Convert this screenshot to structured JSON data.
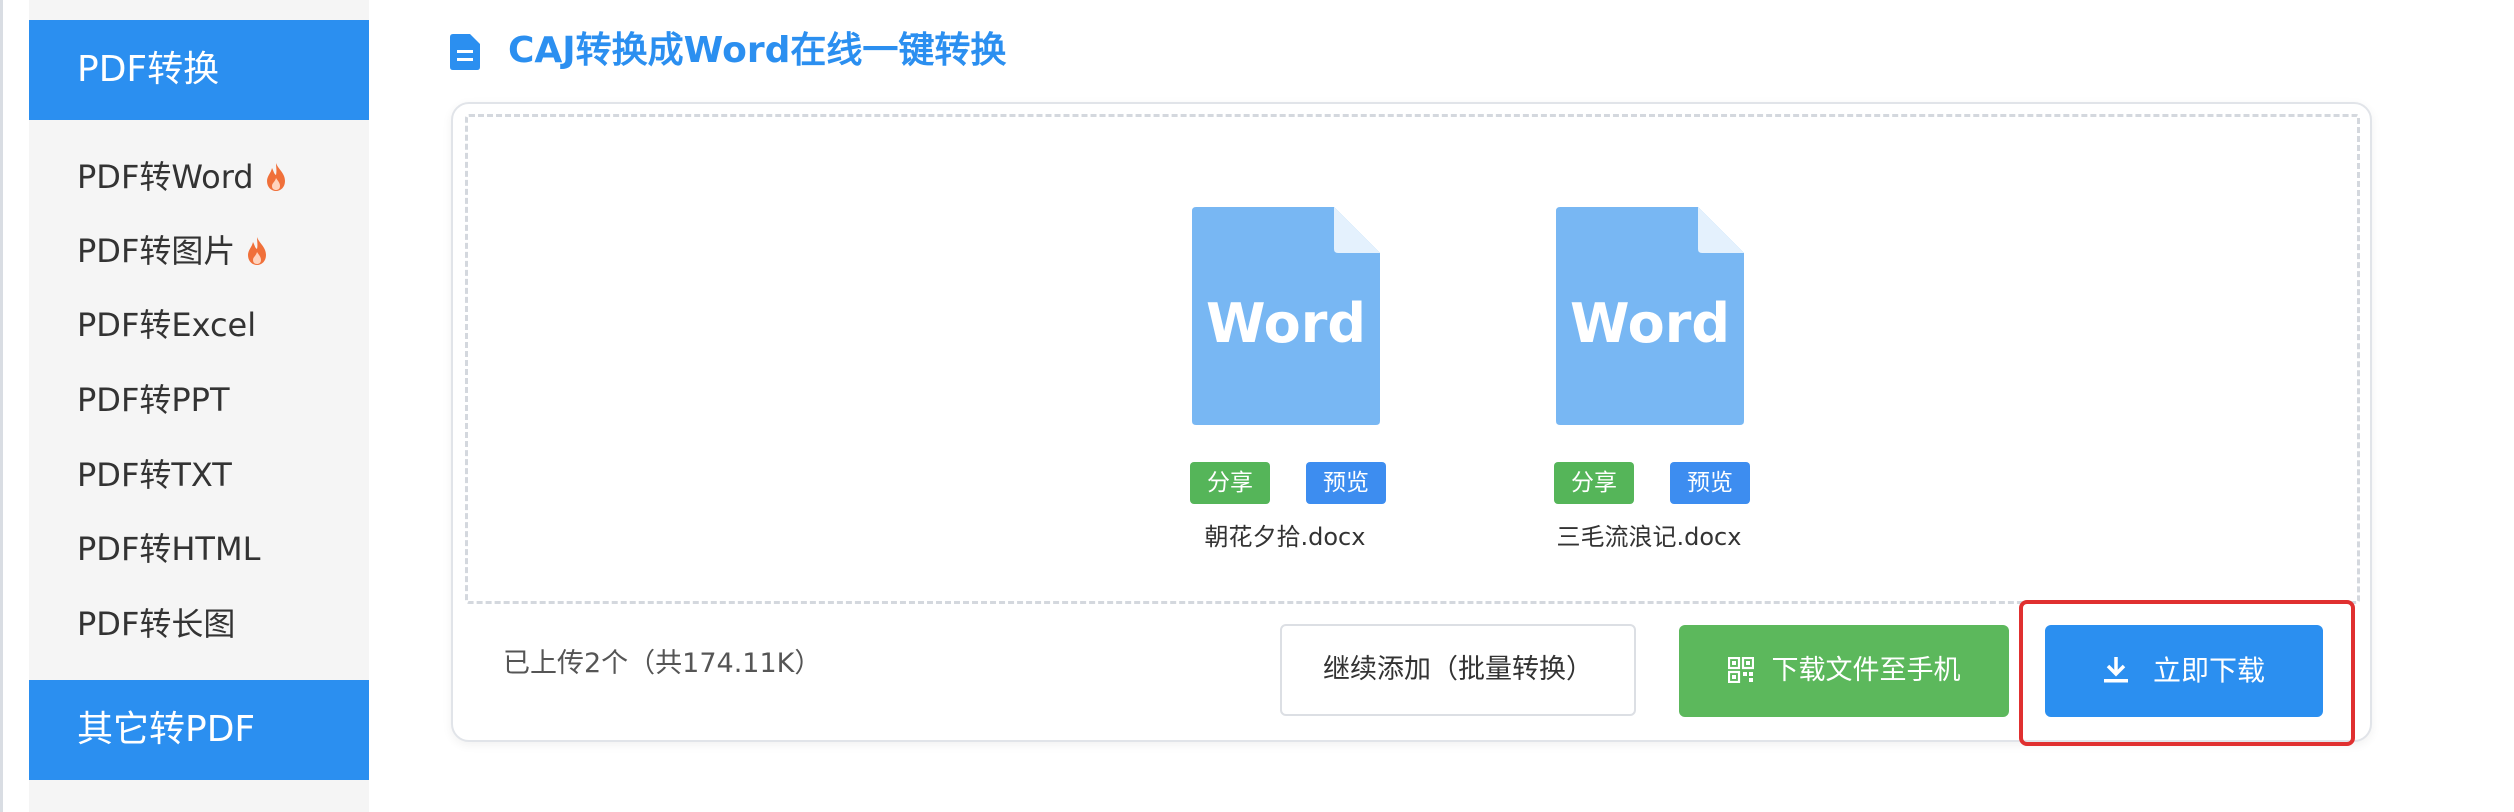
{
  "sidebar": {
    "pdf_section": "PDF转换",
    "items": [
      {
        "label": "PDF转Word",
        "hot": true
      },
      {
        "label": "PDF转图片",
        "hot": true
      },
      {
        "label": "PDF转Excel",
        "hot": false
      },
      {
        "label": "PDF转PPT",
        "hot": false
      },
      {
        "label": "PDF转TXT",
        "hot": false
      },
      {
        "label": "PDF转HTML",
        "hot": false
      },
      {
        "label": "PDF转长图",
        "hot": false
      }
    ],
    "other_section": "其它转PDF"
  },
  "main": {
    "title": "CAJ转换成Word在线一键转换",
    "files": [
      {
        "icon_text": "Word",
        "name": "朝花夕拾.docx",
        "share_label": "分享",
        "preview_label": "预览"
      },
      {
        "icon_text": "Word",
        "name": "三毛流浪记.docx",
        "share_label": "分享",
        "preview_label": "预览"
      }
    ],
    "upload_status": "已上传2个（共174.11K）",
    "continue_label": "继续添加（批量转换）",
    "mobile_download_label": "下载文件至手机",
    "download_label": "立即下载"
  },
  "icons": {
    "title": "document-list-icon",
    "hot": "flame-icon",
    "file": "word-document-icon",
    "mobile": "qr-code-icon",
    "download": "download-arrow-icon"
  },
  "colors": {
    "accent_blue": "#2b8ff0",
    "share_green": "#55b559",
    "mobile_button_green": "#5cb85c",
    "doc_icon_blue": "#78b7f3",
    "hot_orange": "#f0703a",
    "highlight_red": "#e03030"
  }
}
